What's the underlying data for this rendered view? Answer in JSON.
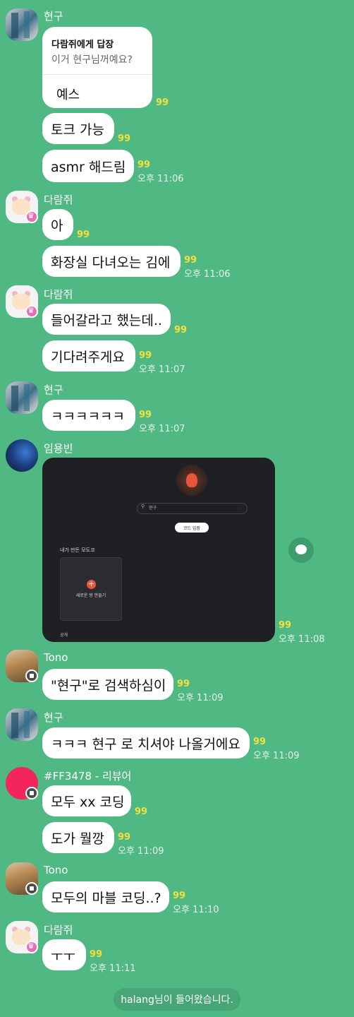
{
  "messages": {
    "m1": {
      "sender": "현구",
      "reply_title": "다람쥐에게 답장",
      "reply_quote": "이거 현구님꺼예요?",
      "text": "예스",
      "count": "99"
    },
    "m2": {
      "text": "토크 가능",
      "count": "99"
    },
    "m3": {
      "text": "asmr 해드림",
      "count": "99",
      "time": "오후 11:06"
    },
    "m4": {
      "sender": "다람쥐",
      "text": "아",
      "count": "99"
    },
    "m5": {
      "text": "화장실 다녀오는 김에",
      "count": "99",
      "time": "오후 11:06"
    },
    "m6": {
      "sender": "다람쥐",
      "text": "들어갈라고 했는데..",
      "count": "99"
    },
    "m7": {
      "text": "기다려주게요",
      "count": "99",
      "time": "오후 11:07"
    },
    "m8": {
      "sender": "현구",
      "text": "ㅋㅋㅋㅋㅋㅋ",
      "count": "99",
      "time": "오후 11:07"
    },
    "m9": {
      "sender": "임용빈",
      "count": "99",
      "time": "오후 11:08",
      "image": {
        "search_text": "현구",
        "button": "코드 입장",
        "section": "내가 만든 모도코",
        "new_room": "새로운 방 만들기",
        "footer": "공개"
      }
    },
    "m10": {
      "sender": "Tono",
      "text": "\"현구\"로 검색하심이",
      "count": "99",
      "time": "오후 11:09"
    },
    "m11": {
      "sender": "현구",
      "text": "ㅋㅋㅋ 현구 로 치셔야 나올거에요",
      "count": "99",
      "time": "오후 11:09"
    },
    "m12": {
      "sender": "#FF3478 - 리뷰어",
      "text": "모두 xx 코딩",
      "count": "99"
    },
    "m13": {
      "text": "도가 뭘깡",
      "count": "99",
      "time": "오후 11:09"
    },
    "m14": {
      "sender": "Tono",
      "text": "모두의 마블 코딩..?",
      "count": "99",
      "time": "오후 11:10"
    },
    "m15": {
      "sender": "다람쥐",
      "text": "ㅜㅜ",
      "count": "99",
      "time": "오후 11:11"
    }
  },
  "system": {
    "join_notice": "halang님이 들어왔습니다."
  },
  "colors": {
    "background": "#4fb883",
    "bubble": "#ffffff",
    "unread_count": "#f4e03c",
    "dark_image": "#1f2023"
  }
}
